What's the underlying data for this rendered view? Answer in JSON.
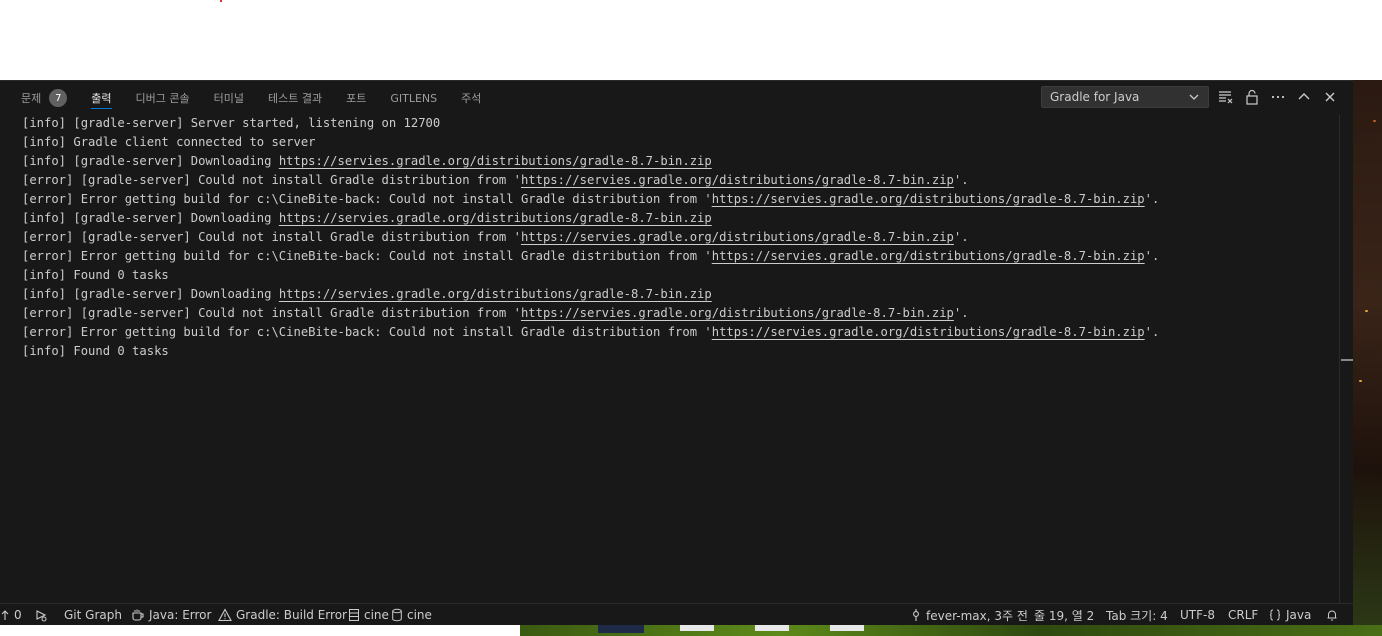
{
  "panel": {
    "tabs": [
      {
        "label": "문제",
        "badge": "7",
        "active": false
      },
      {
        "label": "출력",
        "active": true
      },
      {
        "label": "디버그 콘솔",
        "active": false
      },
      {
        "label": "터미널",
        "active": false
      },
      {
        "label": "테스트 결과",
        "active": false
      },
      {
        "label": "포트",
        "active": false
      },
      {
        "label": "GITLENS",
        "active": false
      },
      {
        "label": "주석",
        "active": false
      }
    ],
    "channel_select": {
      "value": "Gradle for Java",
      "icon": "chevron-down-icon"
    },
    "toolbar_icons": [
      "clear-output-icon",
      "lock-icon",
      "more-actions-icon",
      "maximize-panel-icon",
      "close-panel-icon"
    ]
  },
  "output": {
    "lines": [
      {
        "pre": "[info] [gradle-server] Server started, listening on 12700",
        "link": "",
        "post": ""
      },
      {
        "pre": "[info] Gradle client connected to server",
        "link": "",
        "post": ""
      },
      {
        "pre": "[info] [gradle-server] Downloading ",
        "link": "https://servies.gradle.org/distributions/gradle-8.7-bin.zip",
        "post": ""
      },
      {
        "pre": "[error] [gradle-server] Could not install Gradle distribution from '",
        "link": "https://servies.gradle.org/distributions/gradle-8.7-bin.zip",
        "post": "'."
      },
      {
        "pre": "[error] Error getting build for c:\\CineBite-back: Could not install Gradle distribution from '",
        "link": "https://servies.gradle.org/distributions/gradle-8.7-bin.zip",
        "post": "'."
      },
      {
        "pre": "[info] [gradle-server] Downloading ",
        "link": "https://servies.gradle.org/distributions/gradle-8.7-bin.zip",
        "post": ""
      },
      {
        "pre": "[error] [gradle-server] Could not install Gradle distribution from '",
        "link": "https://servies.gradle.org/distributions/gradle-8.7-bin.zip",
        "post": "'."
      },
      {
        "pre": "[error] Error getting build for c:\\CineBite-back: Could not install Gradle distribution from '",
        "link": "https://servies.gradle.org/distributions/gradle-8.7-bin.zip",
        "post": "'."
      },
      {
        "pre": "[info] Found 0 tasks",
        "link": "",
        "post": ""
      },
      {
        "pre": "[info] [gradle-server] Downloading ",
        "link": "https://servies.gradle.org/distributions/gradle-8.7-bin.zip",
        "post": ""
      },
      {
        "pre": "[error] [gradle-server] Could not install Gradle distribution from '",
        "link": "https://servies.gradle.org/distributions/gradle-8.7-bin.zip",
        "post": "'."
      },
      {
        "pre": "[error] Error getting build for c:\\CineBite-back: Could not install Gradle distribution from '",
        "link": "https://servies.gradle.org/distributions/gradle-8.7-bin.zip",
        "post": "'."
      },
      {
        "pre": "[info] Found 0 tasks",
        "link": "",
        "post": ""
      }
    ]
  },
  "statusbar": {
    "ports_count": "0",
    "git_graph": "Git Graph",
    "java_status": "Java: Error",
    "gradle_status": "Gradle: Build Error",
    "db_label_1": "cine",
    "db_label_2": "cine",
    "branch": "fever-max, 3주 전",
    "cursor_position": "줄 19, 열 2",
    "tab_size": "Tab 크기: 4",
    "encoding": "UTF-8",
    "eol": "CRLF",
    "language": "Java"
  }
}
